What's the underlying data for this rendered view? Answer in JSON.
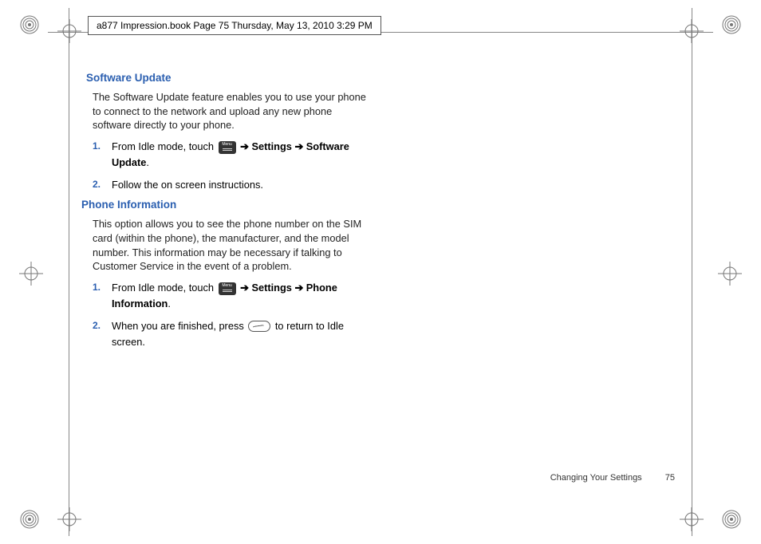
{
  "header": {
    "running_title": "a877 Impression.book  Page 75  Thursday, May 13, 2010  3:29 PM"
  },
  "sections": {
    "sw": {
      "heading": "Software Update",
      "intro": "The Software Update feature enables you to use your phone to connect to the network and upload any new phone software directly to your phone.",
      "step1_num": "1.",
      "step1_a": "From Idle mode, touch ",
      "step1_arrow1": " ➔ ",
      "step1_b": "Settings",
      "step1_arrow2": "  ➔ ",
      "step1_c": "Software Update",
      "step1_end": ".",
      "step2_num": "2.",
      "step2": "Follow the on screen instructions."
    },
    "pi": {
      "heading": "Phone Information",
      "intro": "This option allows you to see the phone number on the SIM card (within the phone), the manufacturer, and the model number. This information may be necessary if talking to Customer Service in the event of a problem.",
      "step1_num": "1.",
      "step1_a": "From Idle mode, touch ",
      "step1_arrow1": " ➔ ",
      "step1_b": "Settings",
      "step1_arrow2": "  ➔ ",
      "step1_c": "Phone Information",
      "step1_end": ".",
      "step2_num": "2.",
      "step2_a": "When you are finished, press ",
      "step2_b": " to return to Idle screen."
    }
  },
  "footer": {
    "chapter": "Changing Your Settings",
    "page": "75"
  },
  "icons": {
    "menu_label": "Menu"
  }
}
